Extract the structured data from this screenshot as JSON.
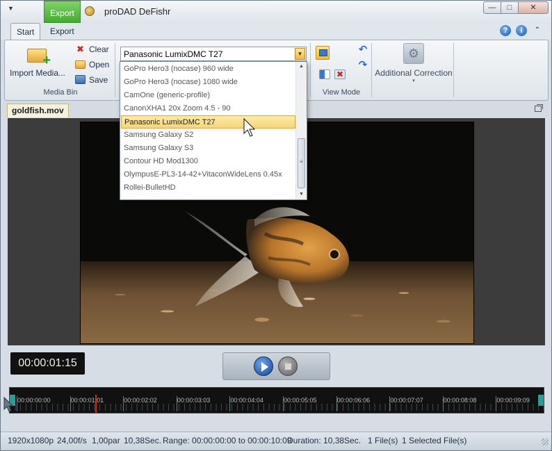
{
  "titlebar": {
    "context_tab": "Export",
    "title": "proDAD DeFishr",
    "minimize": "—",
    "maximize": "□",
    "close": "✕"
  },
  "ribbon_tabs": [
    {
      "label": "Start",
      "active": true
    },
    {
      "label": "Export",
      "active": false
    }
  ],
  "help": {
    "question": "?",
    "info": "i",
    "collapse": "⌃"
  },
  "ribbon": {
    "import_label": "Import Media...",
    "clear_label": "Clear",
    "open_label": "Open",
    "save_label": "Save",
    "media_bin_group": "Media Bin",
    "camera_profile": "Panasonic LumixDMC T27",
    "view_mode_group": "View Mode",
    "additional_correction": "Additional Correction",
    "caret": "▾"
  },
  "profile_dropdown": {
    "items": [
      "GoPro Hero3 (nocase) 960 wide",
      "GoPro Hero3 (nocase) 1080 wide",
      "CamOne (generic-profile)",
      "CanonXHA1 20x Zoom 4.5 - 90",
      "Panasonic LumixDMC T27",
      "Samsung Galaxy S2",
      "Samsung Galaxy S3",
      "Contour HD Mod1300",
      "OlympusE-PL3-14-42+VitaconWideLens 0.45x",
      "Rollei-BulletHD"
    ],
    "selected_index": 4,
    "scroll_up": "▲",
    "scroll_down": "▼"
  },
  "document": {
    "tab": "goldfish.mov"
  },
  "playback": {
    "timecode": "00:00:01:15"
  },
  "timeline": {
    "labels": [
      "00:00:00:00",
      "00:00:01:01",
      "00:00:02:02",
      "00:00:03:03",
      "00:00:04:04",
      "00:00:05:05",
      "00:00:06:06",
      "00:00:07:07",
      "00:00:08:08",
      "00:00:09:09"
    ],
    "playhead_fraction": 0.15
  },
  "status": {
    "resolution": "1920x1080p",
    "fps": "24,00f/s",
    "par": "1,00par",
    "length": "10,38Sec.",
    "range": "Range: 00:00:00:00 to 00:00:10:09",
    "duration": "Duration: 10,38Sec.",
    "files": "1 File(s)",
    "selected": "1 Selected File(s)"
  },
  "colors": {
    "context_tab": "#43ab2f",
    "selected_item": "#f5d57a",
    "play_button": "#12438f",
    "playhead": "#d0261c"
  }
}
